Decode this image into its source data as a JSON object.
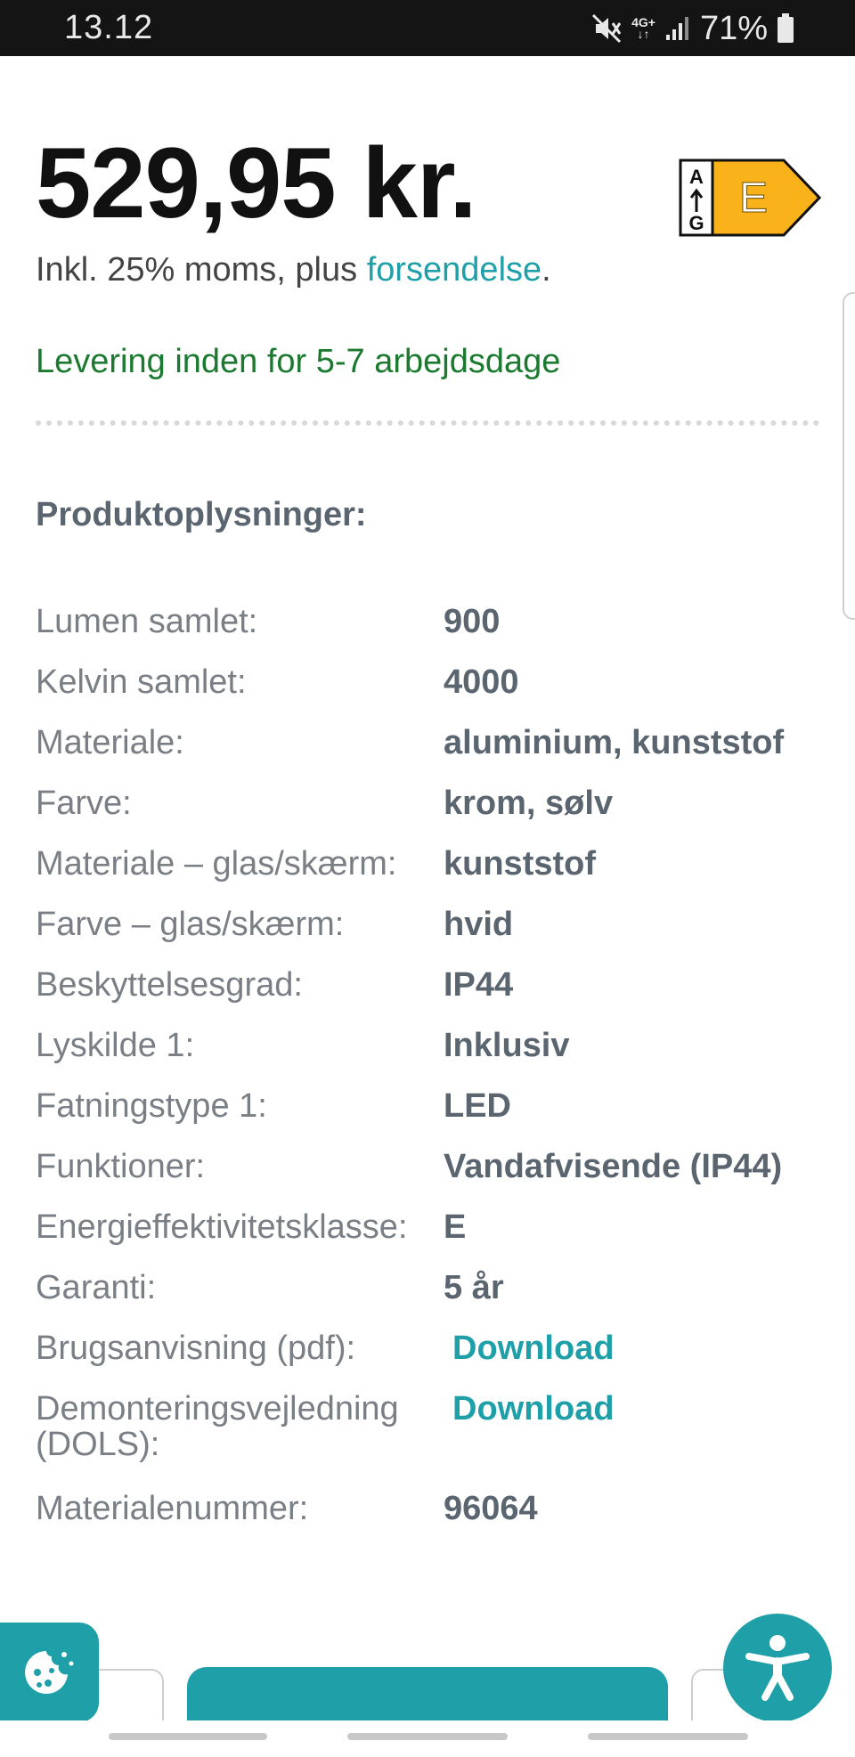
{
  "status_bar": {
    "time": "13.12",
    "network_top": "4G+",
    "network_bottom": "↓↑",
    "battery": "71%"
  },
  "product": {
    "price": "529,95 kr.",
    "vat_prefix": "Inkl. 25% moms, plus ",
    "vat_link": "forsendelse",
    "vat_suffix": ".",
    "delivery": "Levering inden for 5-7 arbejdsdage",
    "energy_label": {
      "scale_top": "A",
      "scale_bottom": "G",
      "class": "E",
      "color": "#f9b21a"
    }
  },
  "specs": {
    "title": "Produktoplysninger:",
    "rows": [
      {
        "label": "Lumen samlet:",
        "value": "900"
      },
      {
        "label": "Kelvin samlet:",
        "value": "4000"
      },
      {
        "label": "Materiale:",
        "value": "aluminium, kunststof"
      },
      {
        "label": "Farve:",
        "value": "krom, sølv"
      },
      {
        "label": "Materiale – glas/skærm:",
        "value": "kunststof"
      },
      {
        "label": "Farve – glas/skærm:",
        "value": "hvid"
      },
      {
        "label": "Beskyttelsesgrad:",
        "value": "IP44"
      },
      {
        "label": "Lyskilde 1:",
        "value": "Inklusiv"
      },
      {
        "label": "Fatningstype 1:",
        "value": "LED"
      },
      {
        "label": "Funktioner:",
        "value": "Vandafvisende (IP44)"
      },
      {
        "label": "Energieffektivitetsklasse:",
        "value": "E"
      },
      {
        "label": "Garanti:",
        "value": "5 år"
      },
      {
        "label": "Brugsanvisning (pdf):",
        "value": "Download"
      },
      {
        "label": "Demonteringsvejledning (DOLS):",
        "value": "Download"
      },
      {
        "label": "Materialenummer:",
        "value": "96064"
      }
    ]
  },
  "colors": {
    "accent": "#1f9fa8",
    "delivery_green": "#1b7a30"
  }
}
